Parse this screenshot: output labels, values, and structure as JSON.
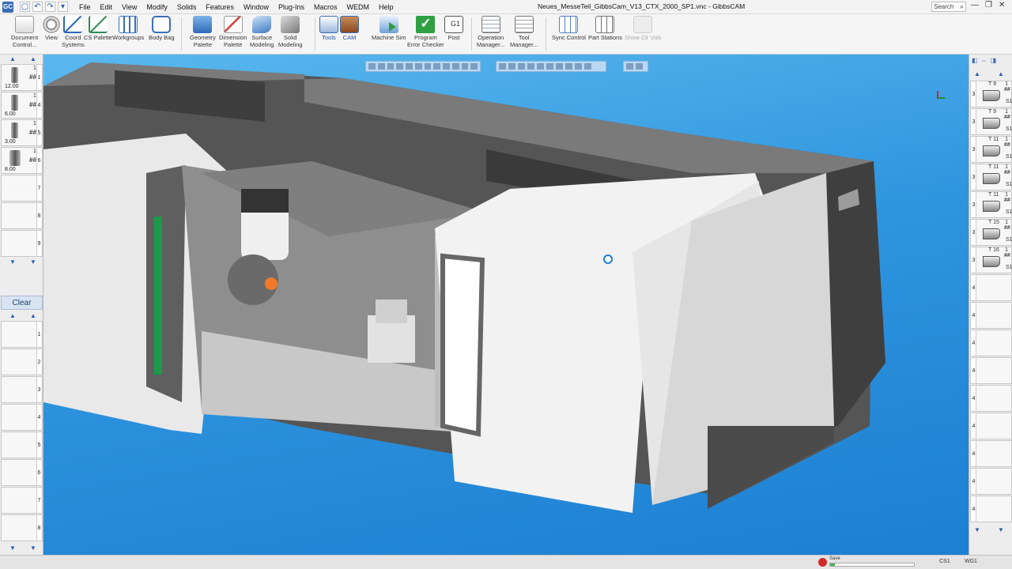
{
  "window": {
    "title": "Neues_MesseTeil_GibbsCam_V13_CTX_2000_SP1.vnc - GibbsCAM",
    "app_icon": "GC",
    "search_placeholder": "Search",
    "controls": {
      "minimize": "—",
      "restore": "❐",
      "close": "✕"
    }
  },
  "menu": [
    "File",
    "Edit",
    "View",
    "Modify",
    "Solids",
    "Features",
    "Window",
    "Plug-Ins",
    "Macros",
    "WEDM",
    "Help"
  ],
  "toolbar": {
    "document_control": "Document\nControl...",
    "view": "View",
    "coord_systems": "Coord\nSystems",
    "cs_palette": "CS Palette",
    "workgroups": "Workgroups",
    "body_bag": "Body Bag",
    "geometry_palette": "Geometry\nPalette",
    "dimension_palette": "Dimension\nPalette",
    "surface_modeling": "Surface\nModeling",
    "solid_modeling": "Solid\nModeling",
    "tools": "Tools",
    "cam": "CAM",
    "machine_sim": "Machine Sim",
    "program_error_checker": "Program\nError Checker",
    "post": "Post",
    "operation_manager": "Operation\nManager...",
    "tool_manager": "Tool\nManager...",
    "sync_control": "Sync Control",
    "part_stations": "Part Stations",
    "show_clr_vols": "Show Clr Vols"
  },
  "left_palette": {
    "tools": [
      {
        "number": "1",
        "diameter": "12.00",
        "mark": "##",
        "index": "1"
      },
      {
        "number": "1",
        "diameter": "6.00",
        "mark": "##",
        "index": "4"
      },
      {
        "number": "1",
        "diameter": "3.00",
        "mark": "##",
        "index": "5"
      },
      {
        "number": "1",
        "diameter": "8.00",
        "mark": "##",
        "index": "6"
      }
    ],
    "empty_indices": [
      "7",
      "8",
      "9"
    ],
    "clear_label": "Clear",
    "lower_indices": [
      "1",
      "2",
      "3",
      "4",
      "5",
      "6",
      "7",
      "8"
    ]
  },
  "right_palette": {
    "tools": [
      {
        "tno": "T 9",
        "one": "1",
        "mark": "##",
        "s": "S1",
        "index": "3"
      },
      {
        "tno": "T 9",
        "one": "1",
        "mark": "##",
        "s": "S1",
        "index": "3"
      },
      {
        "tno": "T 11",
        "one": "1",
        "mark": "##",
        "s": "S1",
        "index": "3"
      },
      {
        "tno": "T 11",
        "one": "1",
        "mark": "##",
        "s": "S1",
        "index": "3"
      },
      {
        "tno": "T 11",
        "one": "1",
        "mark": "##",
        "s": "S1",
        "index": "3"
      },
      {
        "tno": "T 15",
        "one": "1",
        "mark": "##",
        "s": "S1",
        "index": "3"
      },
      {
        "tno": "T 16",
        "one": "1",
        "mark": "##",
        "s": "S1",
        "index": "3"
      }
    ],
    "empty_indices": [
      "4",
      "4",
      "4",
      "4",
      "4",
      "4",
      "4",
      "4",
      "4"
    ]
  },
  "status": {
    "save_label": "Save",
    "save_progress": 0.06,
    "cs": "CS1",
    "wg": "WG1"
  }
}
